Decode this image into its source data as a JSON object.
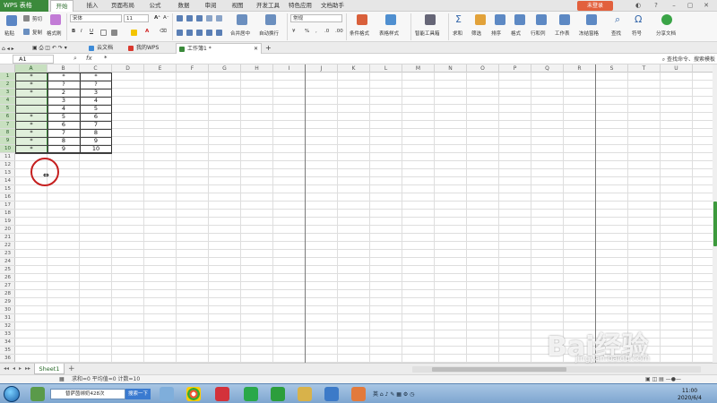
{
  "app": {
    "name": "WPS 表格",
    "login": "未登录"
  },
  "menu": {
    "tabs": [
      "开始",
      "插入",
      "页面布局",
      "公式",
      "数据",
      "审阅",
      "视图",
      "开发工具",
      "特色应用",
      "文档助手"
    ],
    "active": 0
  },
  "ribbon": {
    "paste": "粘贴",
    "cut": "剪切",
    "copy": "复制",
    "format_painter": "格式刷",
    "font_name": "宋体",
    "font_size": "11",
    "merge_center": "合并居中",
    "auto_wrap": "自动换行",
    "number_format": "常规",
    "conditional_format": "条件格式",
    "table_style": "表格样式",
    "smart_toolbox": "智能工具箱",
    "sum": "求和",
    "filter": "筛选",
    "sort": "排序",
    "format": "格式",
    "row_col": "行和列",
    "worksheet": "工作表",
    "freeze": "冻结窗格",
    "find": "查找",
    "symbol": "符号",
    "share": "分享文档"
  },
  "doc_tabs": {
    "cloud": "云文档",
    "my_wps": "我的WPS",
    "workbook": "工作簿1 *"
  },
  "formula_bar": {
    "name_box": "A1",
    "fx": "fx",
    "content": "*",
    "search": "查找命令、搜索模板"
  },
  "columns": [
    "A",
    "B",
    "C",
    "D",
    "E",
    "F",
    "G",
    "H",
    "I",
    "J",
    "K",
    "L",
    "M",
    "N",
    "O",
    "P",
    "Q",
    "R",
    "S",
    "T",
    "U"
  ],
  "rows": [
    "1",
    "2",
    "3",
    "4",
    "5",
    "6",
    "7",
    "8",
    "9",
    "10",
    "11",
    "12",
    "13",
    "14",
    "15",
    "16",
    "17",
    "18",
    "19",
    "20",
    "21",
    "22",
    "23",
    "24",
    "25",
    "26",
    "27",
    "28",
    "29",
    "30",
    "31",
    "32",
    "33",
    "34",
    "35",
    "36"
  ],
  "table": [
    [
      "*",
      "*",
      "*"
    ],
    [
      "*",
      "?",
      "?"
    ],
    [
      "*",
      "2",
      "3"
    ],
    [
      "",
      "3",
      "4"
    ],
    [
      "",
      "4",
      "5"
    ],
    [
      "*",
      "5",
      "6"
    ],
    [
      "*",
      "6",
      "7"
    ],
    [
      "*",
      "7",
      "8"
    ],
    [
      "*",
      "8",
      "9"
    ],
    [
      "*",
      "9",
      "10"
    ]
  ],
  "sheet": {
    "name": "Sheet1",
    "add": "+"
  },
  "status": {
    "text": "求和=0  平均值=0  计数=10"
  },
  "taskbar": {
    "search_text": "替萨茵绑奶428次",
    "search_btn": "搜索一下",
    "tray": "英",
    "time": "11:00",
    "date": "2020/6/4"
  },
  "watermark": {
    "brand": "Bai经验",
    "url": "jingyan.baidu.com"
  },
  "colors": {
    "accent": "#3b8a3b",
    "selection": "#c8e0c0",
    "marker": "#c51f1f",
    "login": "#e2603d"
  }
}
